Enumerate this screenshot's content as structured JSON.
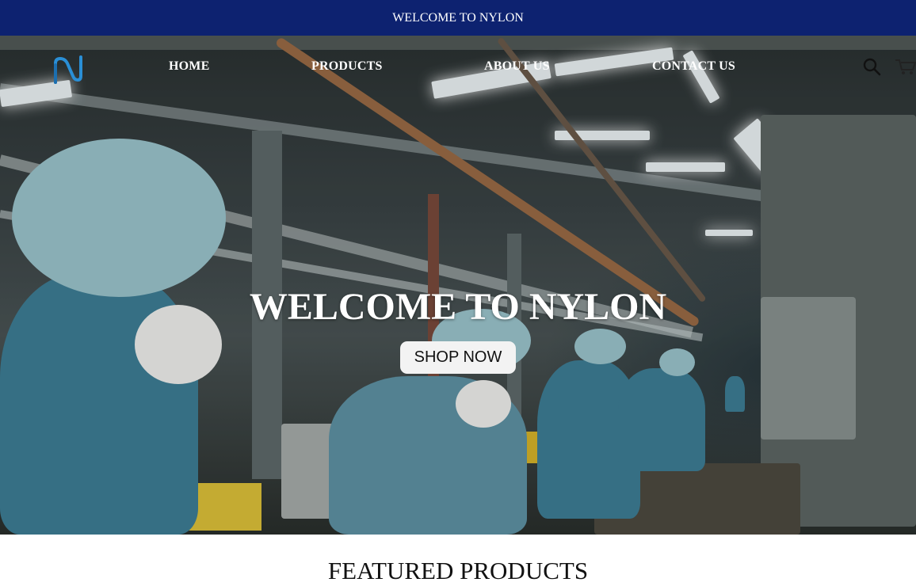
{
  "announcement": {
    "text": "WELCOME TO NYLON"
  },
  "header": {
    "logo_icon": "nylon-n-logo",
    "nav": [
      {
        "label": "HOME"
      },
      {
        "label": "PRODUCTS"
      },
      {
        "label": "ABOUT US"
      },
      {
        "label": "CONTACT US"
      }
    ],
    "search_icon": "search-icon",
    "cart_icon": "cart-icon"
  },
  "hero": {
    "title": "WELCOME TO NYLON",
    "cta_label": "SHOP NOW",
    "image": "factory-workers-photo"
  },
  "featured": {
    "heading": "FEATURED PRODUCTS"
  },
  "colors": {
    "announcement_bg": "#0d2270",
    "logo_blue": "#2a8fd6",
    "button_bg": "#f3f3f3"
  }
}
